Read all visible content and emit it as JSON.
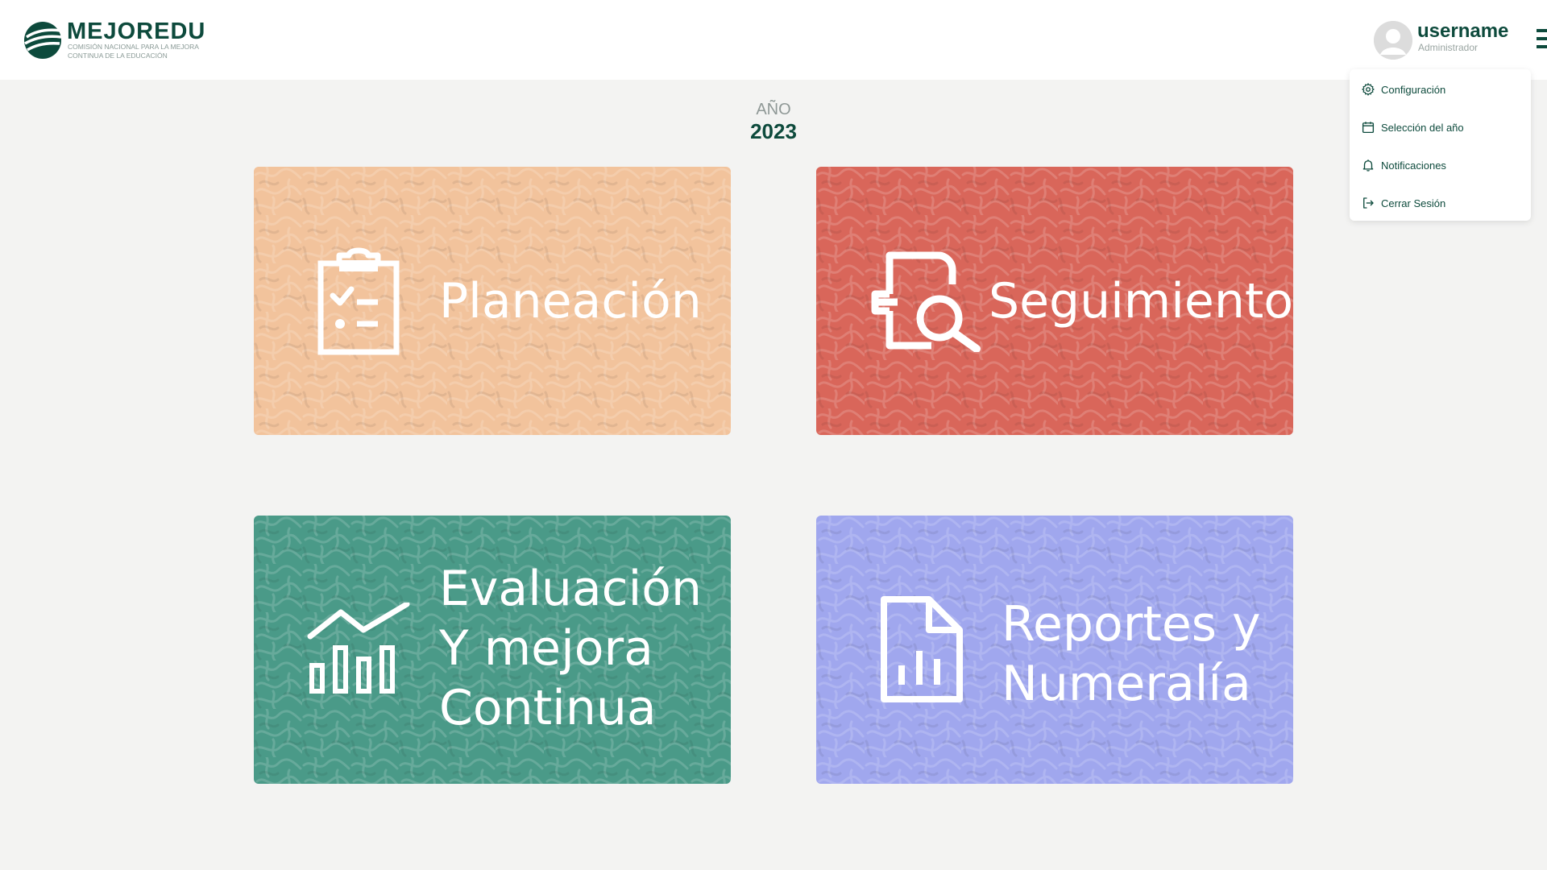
{
  "app": {
    "logo_name": "MEJOREDU",
    "logo_subtitle": "COMISIÓN NACIONAL PARA LA MEJORA CONTINUA DE LA EDUCACIÓN"
  },
  "user": {
    "name": "username",
    "role": "Administrador"
  },
  "menu": {
    "items": [
      {
        "label": "Configuración",
        "icon": "gear-icon"
      },
      {
        "label": "Selección del año",
        "icon": "calendar-icon"
      },
      {
        "label": "Notificaciones",
        "icon": "bell-icon"
      },
      {
        "label": "Cerrar Sesión",
        "icon": "logout-icon"
      }
    ]
  },
  "year": {
    "label": "AÑO",
    "value": "2023"
  },
  "cards": [
    {
      "title": "Planeación",
      "icon": "clipboard-checklist-icon",
      "color": "#f2c39c"
    },
    {
      "title": "Seguimiento",
      "icon": "document-search-icon",
      "color": "#d9665a"
    },
    {
      "title_lines": [
        "Evaluación",
        "Y mejora",
        "Continua"
      ],
      "icon": "bar-chart-trend-icon",
      "color": "#4a9a88"
    },
    {
      "title_lines": [
        "Reportes y",
        "Numeralía"
      ],
      "icon": "document-chart-icon",
      "color": "#a0a7ee"
    }
  ],
  "colors": {
    "brand": "#0d4a3c",
    "background": "#f3f3f2"
  }
}
